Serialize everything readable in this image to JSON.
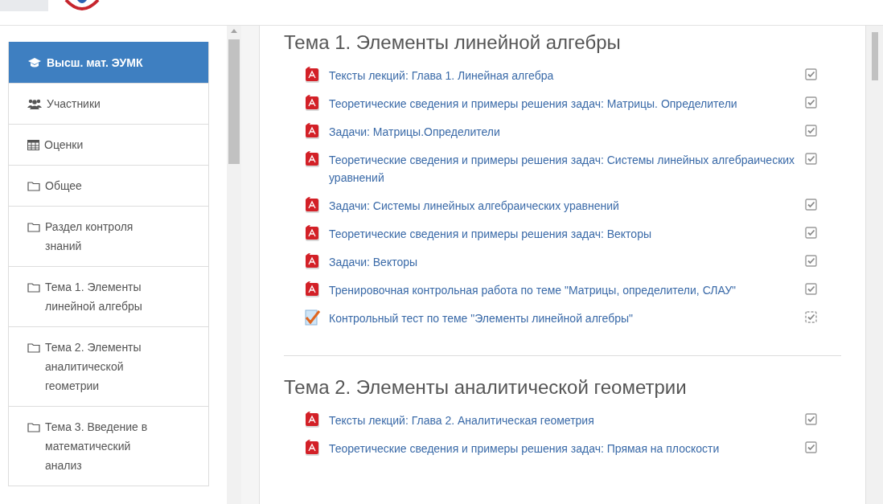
{
  "sidebar": {
    "items": [
      {
        "label": "Высш. мат. ЭУМК",
        "kind": "course",
        "selected": true
      },
      {
        "label": "Участники",
        "kind": "participants",
        "selected": false
      },
      {
        "label": "Оценки",
        "kind": "grades",
        "selected": false
      },
      {
        "label": "Общее",
        "kind": "folder",
        "selected": false
      },
      {
        "label": "Раздел контроля знаний",
        "kind": "folder",
        "selected": false
      },
      {
        "label": "Тема 1. Элементы линейной алгебры",
        "kind": "folder",
        "selected": false
      },
      {
        "label": "Тема 2. Элементы аналитической геометрии",
        "kind": "folder",
        "selected": false
      },
      {
        "label": "Тема 3. Введение в математический анализ",
        "kind": "folder",
        "selected": false
      }
    ]
  },
  "sections": [
    {
      "title": "Тема 1. Элементы линейной алгебры",
      "activities": [
        {
          "kind": "pdf",
          "label": "Тексты лекций: Глава 1. Линейная алгебра",
          "automatic": false,
          "checked": true
        },
        {
          "kind": "pdf",
          "label": "Теоретические сведения и примеры решения задач: Матрицы. Определители",
          "automatic": false,
          "checked": true
        },
        {
          "kind": "pdf",
          "label": "Задачи: Матрицы.Определители",
          "automatic": false,
          "checked": true
        },
        {
          "kind": "pdf",
          "label": "Теоретические сведения и примеры решения задач: Системы линейных алгебраических уравнений",
          "automatic": false,
          "checked": true
        },
        {
          "kind": "pdf",
          "label": "Задачи: Системы линейных алгебраических уравнений",
          "automatic": false,
          "checked": true
        },
        {
          "kind": "pdf",
          "label": "Теоретические сведения и примеры решения задач: Векторы",
          "automatic": false,
          "checked": true
        },
        {
          "kind": "pdf",
          "label": "Задачи: Векторы",
          "automatic": false,
          "checked": true
        },
        {
          "kind": "pdf",
          "label": "Тренировочная контрольная работа по теме \"Матрицы, определители, СЛАУ\"",
          "automatic": false,
          "checked": true
        },
        {
          "kind": "quiz",
          "label": "Контрольный тест по теме \"Элементы линейной алгебры\"",
          "automatic": true,
          "checked": true
        }
      ]
    },
    {
      "title": "Тема 2. Элементы аналитической геометрии",
      "activities": [
        {
          "kind": "pdf",
          "label": "Тексты лекций: Глава 2. Аналитическая геометрия",
          "automatic": false,
          "checked": true
        },
        {
          "kind": "pdf",
          "label": "Теоретические сведения и примеры решения задач: Прямая на плоскости",
          "automatic": false,
          "checked": true
        }
      ]
    }
  ]
}
